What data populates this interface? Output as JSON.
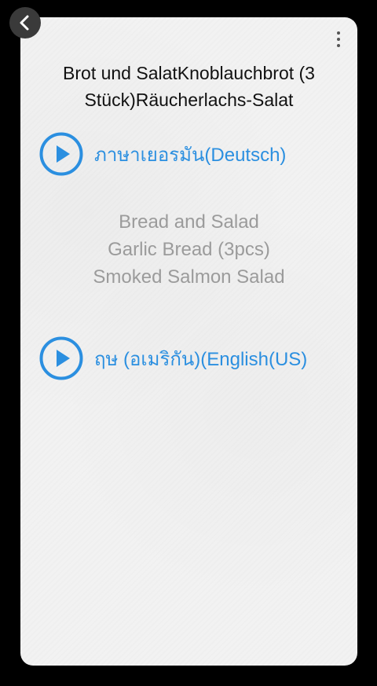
{
  "navigation": {
    "back_icon": "chevron-left-icon",
    "menu_icon": "more-vertical-icon"
  },
  "phrase": {
    "title": "Brot und SalatKnoblauchbrot (3 Stück)Räucherlachs-Salat",
    "translation_lines": [
      "Bread and Salad",
      "Garlic Bread (3pcs)",
      "Smoked Salmon Salad"
    ]
  },
  "audio": [
    {
      "label": "ภาษาเยอรมัน(Deutsch)",
      "icon": "play-icon"
    },
    {
      "label": "ฤษ (อเมริกัน)(English(US)",
      "icon": "play-icon"
    }
  ],
  "colors": {
    "accent": "#2b8fe0",
    "card_background": "#f2f2f2",
    "screen_background": "#000000",
    "translation_text": "#9b9b9b",
    "title_text": "#111111"
  }
}
